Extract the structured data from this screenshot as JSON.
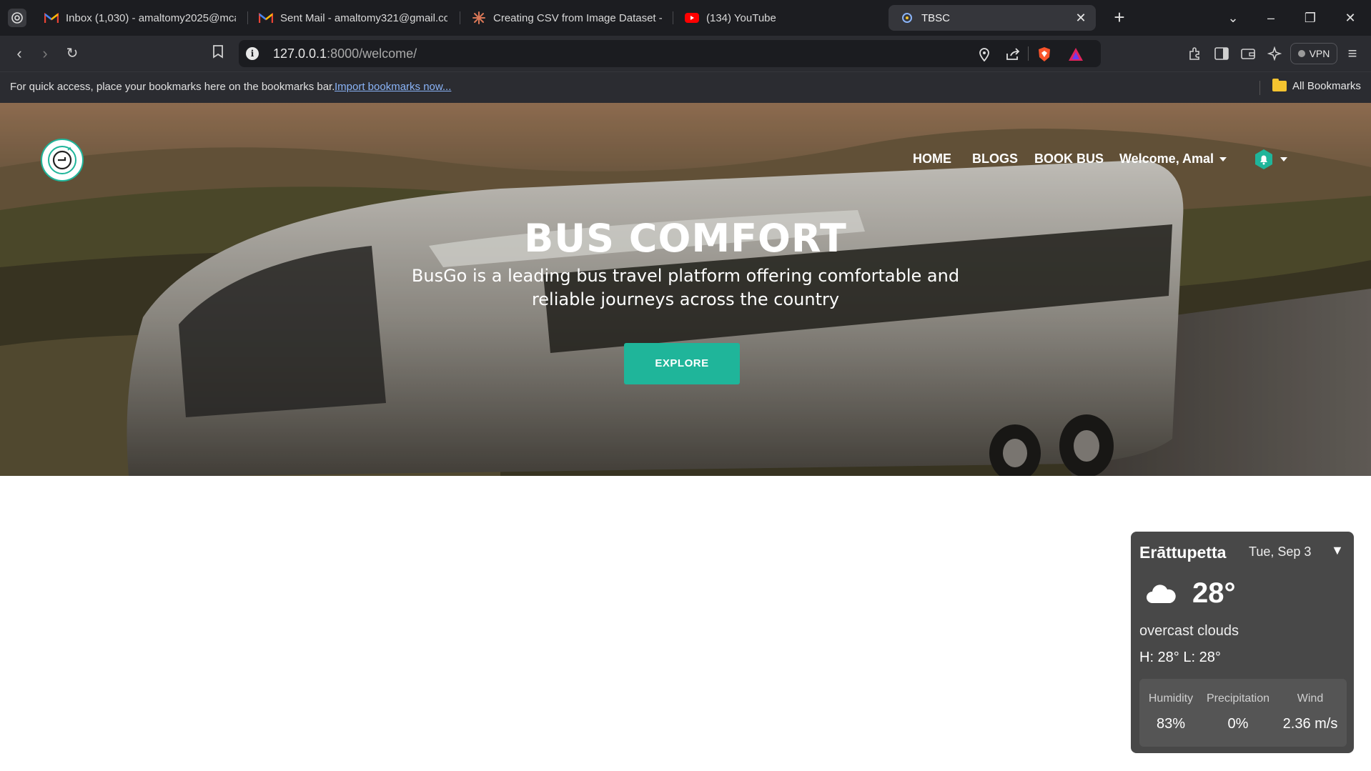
{
  "browser": {
    "tabs": [
      {
        "title": "Inbox (1,030) - amaltomy2025@mca",
        "icon": "gmail-icon"
      },
      {
        "title": "Sent Mail - amaltomy321@gmail.co",
        "icon": "gmail-icon"
      },
      {
        "title": "Creating CSV from Image Dataset -",
        "icon": "claude-icon"
      },
      {
        "title": "(134) YouTube",
        "icon": "youtube-icon"
      },
      {
        "title": "TBSC",
        "icon": "site-icon",
        "active": true
      }
    ],
    "url_host": "127.0.0.1",
    "url_rest": ":8000/welcome/",
    "vpn_label": "VPN",
    "bookmarks_hint": "For quick access, place your bookmarks here on the bookmarks bar.",
    "import_link": "Import bookmarks now...",
    "all_bookmarks": "All Bookmarks"
  },
  "site": {
    "nav": {
      "home": "HOME",
      "blogs": "BLOGS",
      "book_bus": "BOOK BUS",
      "welcome": "Welcome, Amal"
    },
    "hero": {
      "title": "BUS COMFORT",
      "subtitle": "BusGo is a leading bus travel platform offering comfortable and reliable journeys across the country",
      "cta": "EXPLORE"
    },
    "accent_color": "#1fb59a"
  },
  "weather": {
    "location": "Erāttupetta",
    "date": "Tue, Sep 3",
    "toggle": "▼",
    "temperature": "28°",
    "description": "overcast clouds",
    "high_low": "H: 28° L: 28°",
    "icon": "cloud-icon",
    "stats": [
      {
        "label": "Humidity",
        "value": "83%"
      },
      {
        "label": "Precipitation",
        "value": "0%"
      },
      {
        "label": "Wind",
        "value": "2.36 m/s"
      }
    ]
  }
}
